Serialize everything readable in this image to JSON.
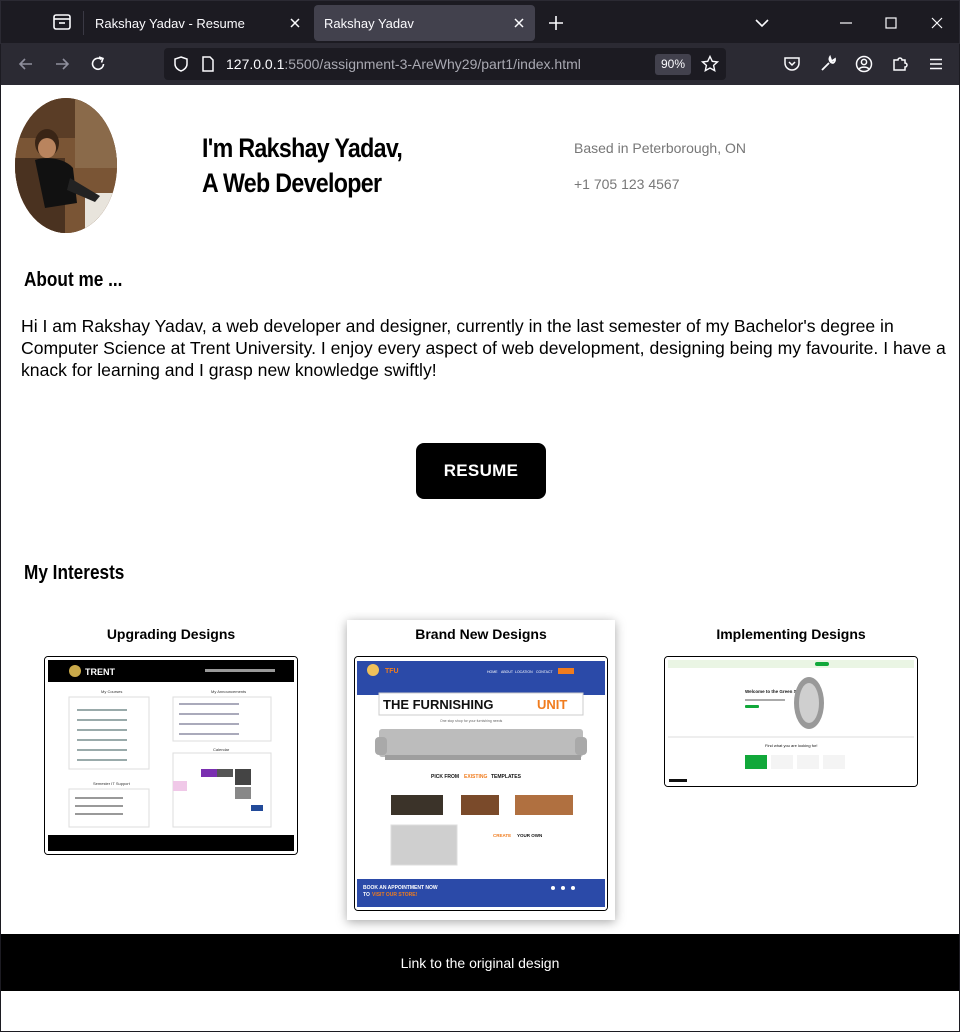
{
  "browser": {
    "tabs": [
      {
        "title": "Rakshay Yadav - Resume"
      },
      {
        "title": "Rakshay Yadav"
      }
    ],
    "url_host": "127.0.0.1",
    "url_rest": ":5500/assignment-3-AreWhy29/part1/index.html",
    "zoom": "90%"
  },
  "hero": {
    "line1": "I'm Rakshay Yadav,",
    "line2": "A Web Developer",
    "location": "Based in Peterborough, ON",
    "phone": "+1 705 123 4567"
  },
  "about": {
    "heading": "About me ...",
    "text": "Hi I am Rakshay Yadav, a web developer and designer, currently in the last semester of my Bachelor's degree in Computer Science at Trent University. I enjoy every aspect of web development, designing being my favourite. I have a knack for learning and I grasp new knowledge swiftly!"
  },
  "resume_label": "RESUME",
  "interests": {
    "heading": "My Interests",
    "cards": [
      {
        "title": "Upgrading Designs",
        "brand": "TRENT",
        "panel_left": "My Courses",
        "panel_right": "My Announcements",
        "calendar": "Calendar",
        "support": "Semester IT Support"
      },
      {
        "title": "Brand New Designs",
        "brand": "TFU",
        "headline": "THE FURNISHING",
        "headline_accent": "UNIT",
        "tagline": "One stop shop for your furnishing needs",
        "pick_a": "PICK FROM",
        "pick_b": "EXISTING",
        "pick_c": "TEMPLATES",
        "create_a": "CREATE",
        "create_b": "YOUR OWN",
        "book": "BOOK AN APPOINTMENT NOW",
        "book2a": "TO",
        "book2b": "VISIT OUR STORE!",
        "nav": [
          "HOME",
          "ABOUT",
          "LOCATION",
          "CONTACT"
        ]
      },
      {
        "title": "Implementing Designs",
        "welcome": "Welcome to the Green Side",
        "find": "Find what you are looking for!"
      }
    ]
  },
  "footer_link": "Link to the original design",
  "colors": {
    "chrome_dark": "#1c1b22",
    "chrome_mid": "#2b2a33",
    "active_tab": "#42414d",
    "tfu_blue": "#2b4aa8",
    "tfu_orange": "#f07c1e",
    "green": "#11a83a"
  }
}
